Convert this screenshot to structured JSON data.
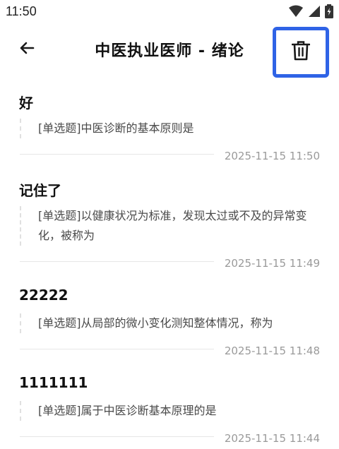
{
  "status_bar": {
    "time": "11:50"
  },
  "header": {
    "title": "中医执业医师 - 绪论"
  },
  "notes": [
    {
      "title": "好",
      "question": "[单选题]中医诊断的基本原则是",
      "time": "2025-11-15 11:50"
    },
    {
      "title": "记住了",
      "question": "[单选题]以健康状况为标准，发现太过或不及的异常变化，被称为",
      "time": "2025-11-15 11:49"
    },
    {
      "title": "22222",
      "question": "[单选题]从局部的微小变化测知整体情况，称为",
      "time": "2025-11-15 11:48"
    },
    {
      "title": "1111111",
      "question": "[单选题]属于中医诊断基本原理的是",
      "time": "2025-11-15 11:44"
    }
  ]
}
